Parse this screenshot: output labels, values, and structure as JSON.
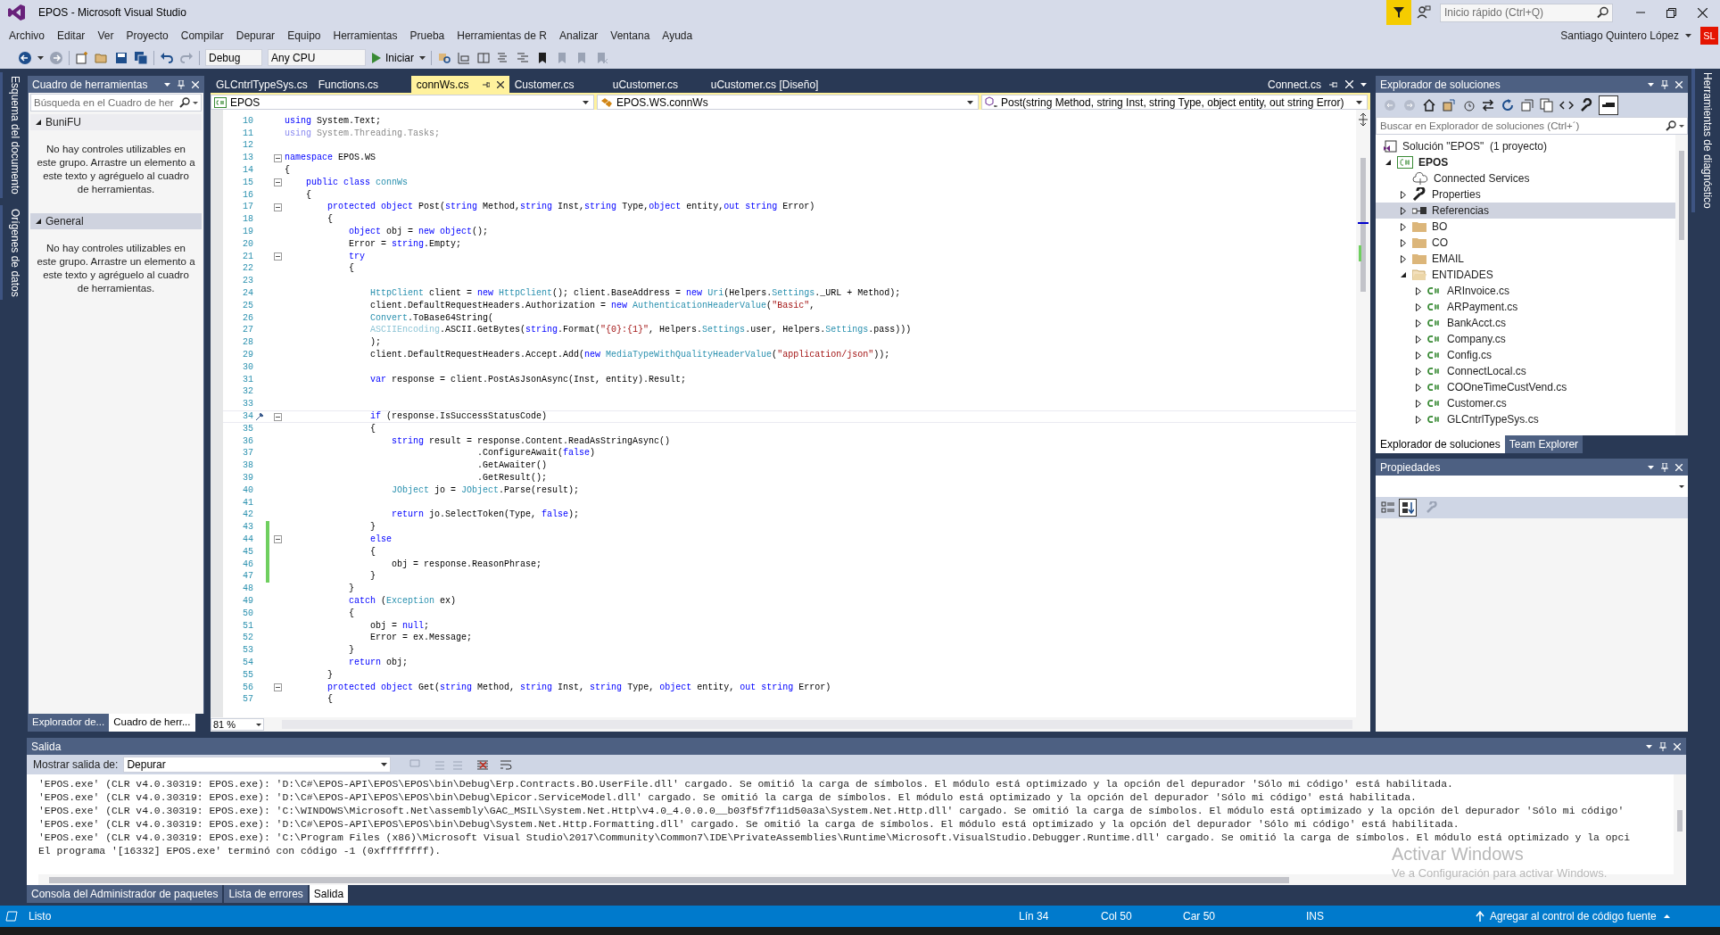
{
  "window": {
    "title": "EPOS - Microsoft Visual Studio"
  },
  "quick_launch": {
    "placeholder": "Inicio rápido (Ctrl+Q)"
  },
  "menu": [
    "Archivo",
    "Editar",
    "Ver",
    "Proyecto",
    "Compilar",
    "Depurar",
    "Equipo",
    "Herramientas",
    "Prueba",
    "Herramientas de R",
    "Analizar",
    "Ventana",
    "Ayuda"
  ],
  "account": {
    "name": "Santiago Quintero López",
    "initials": "SL"
  },
  "toolbar": {
    "configuration": "Debug",
    "platform": "Any CPU",
    "start": "Iniciar"
  },
  "left_rail": [
    "Esquema del documento",
    "Orígenes de datos"
  ],
  "right_rail": [
    "Herramientas de diagnóstico"
  ],
  "toolbox": {
    "title": "Cuadro de herramientas",
    "placeholder": "Búsqueda en el Cuadro de her",
    "groups": [
      {
        "name": "BuniFU",
        "selected": false,
        "message": "No hay controles utilizables en este grupo. Arrastre un elemento a este texto y agréguelo al cuadro de herramientas."
      },
      {
        "name": "General",
        "selected": true,
        "message": "No hay controles utilizables en este grupo. Arrastre un elemento a este texto y agréguelo al cuadro de herramientas."
      }
    ],
    "tabs": [
      {
        "label": "Explorador de...",
        "selected": false
      },
      {
        "label": "Cuadro de herr...",
        "selected": true
      }
    ]
  },
  "editor": {
    "tabs": [
      {
        "label": "GLCntrlTypeSys.cs",
        "selected": false
      },
      {
        "label": "Functions.cs",
        "selected": false
      },
      {
        "label": "connWs.cs",
        "selected": true
      },
      {
        "label": "Customer.cs",
        "selected": false
      },
      {
        "label": "uCustomer.cs",
        "selected": false
      },
      {
        "label": "uCustomer.cs [Diseño]",
        "selected": false
      }
    ],
    "preview_tab": {
      "label": "Connect.cs"
    },
    "nav": {
      "project": "EPOS",
      "type": "EPOS.WS.connWs",
      "member": "Post(string Method, string Inst, string Type, object entity, out string Error)"
    },
    "lines": [
      {
        "n": "10",
        "tokens": [
          {
            "kind": "kw",
            "text": "using"
          },
          {
            "kind": "p",
            "text": " System.Text;"
          }
        ]
      },
      {
        "n": "11",
        "tokens": [
          {
            "kind": "dimkw",
            "text": "using"
          },
          {
            "kind": "dim",
            "text": " System.Threading.Tasks;"
          }
        ]
      },
      {
        "n": "12"
      },
      {
        "n": "13",
        "fold": true,
        "tokens": [
          {
            "kind": "kw",
            "text": "namespace"
          },
          {
            "kind": "p",
            "text": " EPOS.WS"
          }
        ]
      },
      {
        "n": "14",
        "tokens": [
          {
            "kind": "p",
            "text": "{"
          }
        ]
      },
      {
        "n": "15",
        "fold": true,
        "tokens": [
          {
            "kind": "kw",
            "text": "    public class"
          },
          {
            "kind": "type",
            "text": " connWs"
          }
        ]
      },
      {
        "n": "16",
        "tokens": [
          {
            "kind": "p",
            "text": "    {"
          }
        ]
      },
      {
        "n": "17",
        "fold": true,
        "tokens": [
          {
            "kind": "kw",
            "text": "        protected object"
          },
          {
            "kind": "p",
            "text": " Post("
          },
          {
            "kind": "kw",
            "text": "string"
          },
          {
            "kind": "p",
            "text": " Method,"
          },
          {
            "kind": "kw",
            "text": "string"
          },
          {
            "kind": "p",
            "text": " Inst,"
          },
          {
            "kind": "kw",
            "text": "string"
          },
          {
            "kind": "p",
            "text": " Type,"
          },
          {
            "kind": "kw",
            "text": "object"
          },
          {
            "kind": "p",
            "text": " entity,"
          },
          {
            "kind": "kw",
            "text": "out string"
          },
          {
            "kind": "p",
            "text": " Error)"
          }
        ]
      },
      {
        "n": "18",
        "tokens": [
          {
            "kind": "p",
            "text": "        {"
          }
        ]
      },
      {
        "n": "19",
        "tokens": [
          {
            "kind": "kw",
            "text": "            object"
          },
          {
            "kind": "p",
            "text": " obj = "
          },
          {
            "kind": "kw",
            "text": "new object"
          },
          {
            "kind": "p",
            "text": "();"
          }
        ]
      },
      {
        "n": "20",
        "tokens": [
          {
            "kind": "p",
            "text": "            Error = "
          },
          {
            "kind": "kw",
            "text": "string"
          },
          {
            "kind": "p",
            "text": ".Empty;"
          }
        ]
      },
      {
        "n": "21",
        "fold": true,
        "tokens": [
          {
            "kind": "kw",
            "text": "            try"
          }
        ]
      },
      {
        "n": "22",
        "tokens": [
          {
            "kind": "p",
            "text": "            {"
          }
        ]
      },
      {
        "n": "23"
      },
      {
        "n": "24",
        "tokens": [
          {
            "kind": "type",
            "text": "                HttpClient"
          },
          {
            "kind": "p",
            "text": " client = "
          },
          {
            "kind": "kw",
            "text": "new"
          },
          {
            "kind": "type",
            "text": " HttpClient"
          },
          {
            "kind": "p",
            "text": "(); client.BaseAddress = "
          },
          {
            "kind": "kw",
            "text": "new"
          },
          {
            "kind": "type",
            "text": " Uri"
          },
          {
            "kind": "p",
            "text": "(Helpers."
          },
          {
            "kind": "type",
            "text": "Settings"
          },
          {
            "kind": "p",
            "text": "._URL + Method);"
          }
        ]
      },
      {
        "n": "25",
        "tokens": [
          {
            "kind": "p",
            "text": "                client.DefaultRequestHeaders.Authorization = "
          },
          {
            "kind": "kw",
            "text": "new"
          },
          {
            "kind": "type",
            "text": " AuthenticationHeaderValue"
          },
          {
            "kind": "p",
            "text": "("
          },
          {
            "kind": "str",
            "text": "\"Basic\""
          },
          {
            "kind": "p",
            "text": ","
          }
        ]
      },
      {
        "n": "26",
        "tokens": [
          {
            "kind": "type",
            "text": "                Convert"
          },
          {
            "kind": "p",
            "text": ".ToBase64String("
          }
        ]
      },
      {
        "n": "27",
        "tokens": [
          {
            "kind": "dimtype",
            "text": "                ASCIIEncoding"
          },
          {
            "kind": "p",
            "text": ".ASCII.GetBytes("
          },
          {
            "kind": "kw",
            "text": "string"
          },
          {
            "kind": "p",
            "text": ".Format("
          },
          {
            "kind": "str",
            "text": "\"{0}:{1}\""
          },
          {
            "kind": "p",
            "text": ", Helpers."
          },
          {
            "kind": "type",
            "text": "Settings"
          },
          {
            "kind": "p",
            "text": ".user, Helpers."
          },
          {
            "kind": "type",
            "text": "Settings"
          },
          {
            "kind": "p",
            "text": ".pass)))"
          }
        ]
      },
      {
        "n": "28",
        "tokens": [
          {
            "kind": "p",
            "text": "                );"
          }
        ]
      },
      {
        "n": "29",
        "tokens": [
          {
            "kind": "p",
            "text": "                client.DefaultRequestHeaders.Accept.Add("
          },
          {
            "kind": "kw",
            "text": "new"
          },
          {
            "kind": "type",
            "text": " MediaTypeWithQualityHeaderValue"
          },
          {
            "kind": "p",
            "text": "("
          },
          {
            "kind": "str",
            "text": "\"application/json\""
          },
          {
            "kind": "p",
            "text": "));"
          }
        ]
      },
      {
        "n": "30"
      },
      {
        "n": "31",
        "tokens": [
          {
            "kind": "kw",
            "text": "                var"
          },
          {
            "kind": "p",
            "text": " response = client.PostAsJsonAsync(Inst, entity).Result;"
          }
        ]
      },
      {
        "n": "32"
      },
      {
        "n": "33"
      },
      {
        "n": "34",
        "fold": true,
        "current": true,
        "tokens": [
          {
            "kind": "kw",
            "text": "                if"
          },
          {
            "kind": "p",
            "text": " (response.IsSuccessStatusCode)"
          }
        ]
      },
      {
        "n": "35",
        "tokens": [
          {
            "kind": "p",
            "text": "                {"
          }
        ]
      },
      {
        "n": "36",
        "tokens": [
          {
            "kind": "kw",
            "text": "                    string"
          },
          {
            "kind": "p",
            "text": " result = response.Content.ReadAsStringAsync()"
          }
        ]
      },
      {
        "n": "37",
        "tokens": [
          {
            "kind": "p",
            "text": "                                    .ConfigureAwait("
          },
          {
            "kind": "kw",
            "text": "false"
          },
          {
            "kind": "p",
            "text": ")"
          }
        ]
      },
      {
        "n": "38",
        "tokens": [
          {
            "kind": "p",
            "text": "                                    .GetAwaiter()"
          }
        ]
      },
      {
        "n": "39",
        "tokens": [
          {
            "kind": "p",
            "text": "                                    .GetResult();"
          }
        ]
      },
      {
        "n": "40",
        "tokens": [
          {
            "kind": "type",
            "text": "                    JObject"
          },
          {
            "kind": "p",
            "text": " jo = "
          },
          {
            "kind": "type",
            "text": "JObject"
          },
          {
            "kind": "p",
            "text": ".Parse(result);"
          }
        ]
      },
      {
        "n": "41"
      },
      {
        "n": "42",
        "tokens": [
          {
            "kind": "kw",
            "text": "                    return"
          },
          {
            "kind": "p",
            "text": " jo.SelectToken(Type, "
          },
          {
            "kind": "kw",
            "text": "false"
          },
          {
            "kind": "p",
            "text": ");"
          }
        ]
      },
      {
        "n": "43",
        "changed": true,
        "tokens": [
          {
            "kind": "p",
            "text": "                }"
          }
        ]
      },
      {
        "n": "44",
        "changed": true,
        "fold": true,
        "tokens": [
          {
            "kind": "kw",
            "text": "                else"
          }
        ]
      },
      {
        "n": "45",
        "changed": true,
        "tokens": [
          {
            "kind": "p",
            "text": "                {"
          }
        ]
      },
      {
        "n": "46",
        "changed": true,
        "tokens": [
          {
            "kind": "p",
            "text": "                    obj = response.ReasonPhrase;"
          }
        ]
      },
      {
        "n": "47",
        "changed": true,
        "tokens": [
          {
            "kind": "p",
            "text": "                }"
          }
        ]
      },
      {
        "n": "48",
        "tokens": [
          {
            "kind": "p",
            "text": "            }"
          }
        ]
      },
      {
        "n": "49",
        "tokens": [
          {
            "kind": "kw",
            "text": "            catch"
          },
          {
            "kind": "p",
            "text": " ("
          },
          {
            "kind": "type",
            "text": "Exception"
          },
          {
            "kind": "p",
            "text": " ex)"
          }
        ]
      },
      {
        "n": "50",
        "tokens": [
          {
            "kind": "p",
            "text": "            {"
          }
        ]
      },
      {
        "n": "51",
        "tokens": [
          {
            "kind": "p",
            "text": "                obj = "
          },
          {
            "kind": "kw",
            "text": "null"
          },
          {
            "kind": "p",
            "text": ";"
          }
        ]
      },
      {
        "n": "52",
        "tokens": [
          {
            "kind": "p",
            "text": "                Error = ex.Message;"
          }
        ]
      },
      {
        "n": "53",
        "tokens": [
          {
            "kind": "p",
            "text": "            }"
          }
        ]
      },
      {
        "n": "54",
        "tokens": [
          {
            "kind": "kw",
            "text": "            return"
          },
          {
            "kind": "p",
            "text": " obj;"
          }
        ]
      },
      {
        "n": "55",
        "tokens": [
          {
            "kind": "p",
            "text": "        }"
          }
        ]
      },
      {
        "n": "56",
        "fold": true,
        "tokens": [
          {
            "kind": "kw",
            "text": "        protected object"
          },
          {
            "kind": "p",
            "text": " Get("
          },
          {
            "kind": "kw",
            "text": "string"
          },
          {
            "kind": "p",
            "text": " Method, "
          },
          {
            "kind": "kw",
            "text": "string"
          },
          {
            "kind": "p",
            "text": " Inst, "
          },
          {
            "kind": "kw",
            "text": "string"
          },
          {
            "kind": "p",
            "text": " Type, "
          },
          {
            "kind": "kw",
            "text": "object"
          },
          {
            "kind": "p",
            "text": " entity, "
          },
          {
            "kind": "kw",
            "text": "out string"
          },
          {
            "kind": "p",
            "text": " Error)"
          }
        ]
      },
      {
        "n": "57",
        "tokens": [
          {
            "kind": "p",
            "text": "        {"
          }
        ]
      }
    ],
    "zoom": "81 %"
  },
  "solution_explorer": {
    "title": "Explorador de soluciones",
    "placeholder": "Buscar en Explorador de soluciones (Ctrl+´)",
    "tree": [
      {
        "label": "Solución \"EPOS\"  (1 proyecto)",
        "kind": "solution",
        "selected": false,
        "children": [
          {
            "label": "EPOS",
            "kind": "project",
            "expanded": true,
            "selected": false,
            "children": [
              {
                "label": "Connected Services",
                "kind": "cloud",
                "selected": false
              },
              {
                "label": "Properties",
                "kind": "wrench",
                "expanded": false,
                "selected": false
              },
              {
                "label": "Referencias",
                "kind": "references",
                "expanded": false,
                "selected": true
              },
              {
                "label": "BO",
                "kind": "folder",
                "expanded": false,
                "selected": false
              },
              {
                "label": "CO",
                "kind": "folder",
                "expanded": false,
                "selected": false
              },
              {
                "label": "EMAIL",
                "kind": "folder",
                "expanded": false,
                "selected": false
              },
              {
                "label": "ENTIDADES",
                "kind": "openfolder",
                "expanded": true,
                "selected": false,
                "children": [
                  {
                    "label": "ARInvoice.cs",
                    "kind": "csfile",
                    "expanded": false,
                    "selected": false
                  },
                  {
                    "label": "ARPayment.cs",
                    "kind": "csfile",
                    "expanded": false,
                    "selected": false
                  },
                  {
                    "label": "BankAcct.cs",
                    "kind": "csfile",
                    "expanded": false,
                    "selected": false
                  },
                  {
                    "label": "Company.cs",
                    "kind": "csfile",
                    "expanded": false,
                    "selected": false
                  },
                  {
                    "label": "Config.cs",
                    "kind": "csfile",
                    "expanded": false,
                    "selected": false
                  },
                  {
                    "label": "ConnectLocal.cs",
                    "kind": "csfile",
                    "expanded": false,
                    "selected": false
                  },
                  {
                    "label": "COOneTimeCustVend.cs",
                    "kind": "csfile",
                    "expanded": false,
                    "selected": false
                  },
                  {
                    "label": "Customer.cs",
                    "kind": "csfile",
                    "expanded": false,
                    "selected": false
                  },
                  {
                    "label": "GLCntrlTypeSys.cs",
                    "kind": "csfile",
                    "expanded": false,
                    "selected": false
                  }
                ]
              }
            ]
          }
        ]
      }
    ],
    "tabs": [
      {
        "label": "Explorador de soluciones",
        "selected": true
      },
      {
        "label": "Team Explorer",
        "selected": false
      }
    ]
  },
  "properties": {
    "title": "Propiedades"
  },
  "output": {
    "title": "Salida",
    "source_label": "Mostrar salida de:",
    "source": "Depurar",
    "lines": [
      "'EPOS.exe' (CLR v4.0.30319: EPOS.exe): 'D:\\C#\\EPOS-API\\EPOS\\EPOS\\bin\\Debug\\Erp.Contracts.BO.UserFile.dll' cargado. Se omitió la carga de símbolos. El módulo está optimizado y la opción del depurador 'Sólo mi código' está habilitada.",
      "'EPOS.exe' (CLR v4.0.30319: EPOS.exe): 'D:\\C#\\EPOS-API\\EPOS\\EPOS\\bin\\Debug\\Epicor.ServiceModel.dll' cargado. Se omitió la carga de símbolos. El módulo está optimizado y la opción del depurador 'Sólo mi código' está habilitada.",
      "'EPOS.exe' (CLR v4.0.30319: EPOS.exe): 'C:\\WINDOWS\\Microsoft.Net\\assembly\\GAC_MSIL\\System.Net.Http\\v4.0_4.0.0.0__b03f5f7f11d50a3a\\System.Net.Http.dll' cargado. Se omitió la carga de símbolos. El módulo está optimizado y la opción del depurador 'Sólo mi código'",
      "'EPOS.exe' (CLR v4.0.30319: EPOS.exe): 'D:\\C#\\EPOS-API\\EPOS\\EPOS\\bin\\Debug\\System.Net.Http.Formatting.dll' cargado. Se omitió la carga de símbolos. El módulo está optimizado y la opción del depurador 'Sólo mi código' está habilitada.",
      "'EPOS.exe' (CLR v4.0.30319: EPOS.exe): 'C:\\Program Files (x86)\\Microsoft Visual Studio\\2017\\Community\\Common7\\IDE\\PrivateAssemblies\\Runtime\\Microsoft.VisualStudio.Debugger.Runtime.dll' cargado. Se omitió la carga de símbolos. El módulo está optimizado y la opci",
      "El programa '[16332] EPOS.exe' terminó con código -1 (0xffffffff)."
    ],
    "tabs": [
      {
        "label": "Consola del Administrador de paquetes",
        "selected": false
      },
      {
        "label": "Lista de errores",
        "selected": false
      },
      {
        "label": "Salida",
        "selected": true
      }
    ]
  },
  "activation_notice": {
    "title": "Activar Windows",
    "text": "Ve a Configuración para activar Windows."
  },
  "status_bar": {
    "state": "Listo",
    "line": "Lín 34",
    "column": "Col 50",
    "char": "Car 50",
    "mode": "INS",
    "source_control": "Agregar al control de código fuente"
  }
}
